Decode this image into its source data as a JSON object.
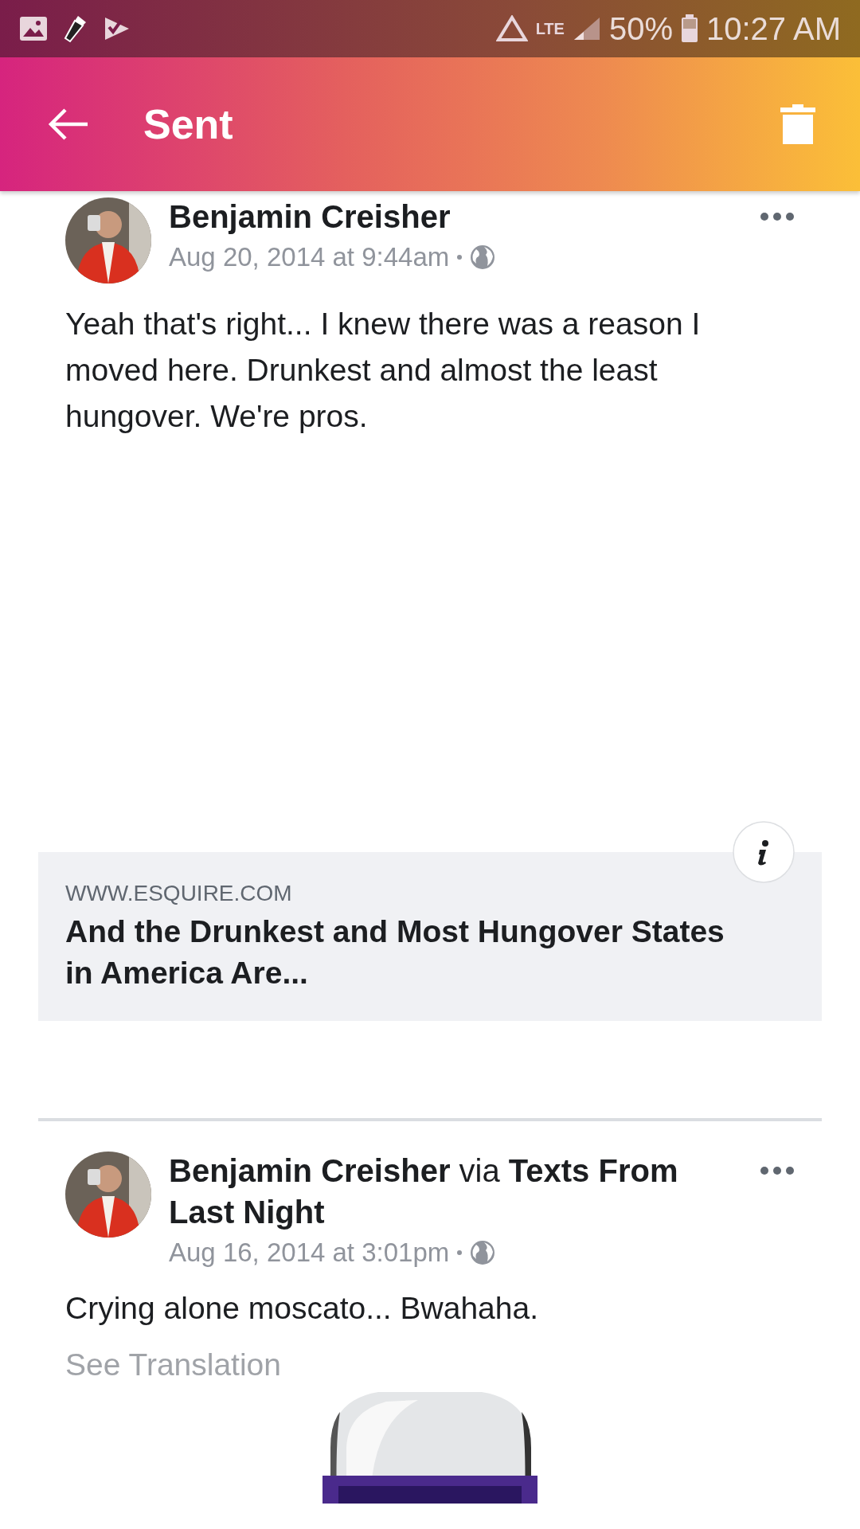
{
  "status_bar": {
    "network": "LTE",
    "battery": "50%",
    "time": "10:27 AM"
  },
  "app_bar": {
    "title": "Sent"
  },
  "posts": [
    {
      "author": "Benjamin Creisher",
      "date": "Aug 20, 2014 at 9:44am",
      "text": "Yeah that's right... I knew there was a reason I moved here. Drunkest and almost the least hungover. We're pros.",
      "link": {
        "domain": "WWW.ESQUIRE.COM",
        "title": "And the Drunkest and Most Hungover States in America Are..."
      }
    },
    {
      "author": "Benjamin Creisher",
      "via": {
        "word": "via",
        "page": "Texts From Last Night"
      },
      "date": "Aug 16, 2014 at 3:01pm",
      "text": "Crying alone moscato... Bwahaha.",
      "translation": "See Translation"
    }
  ]
}
